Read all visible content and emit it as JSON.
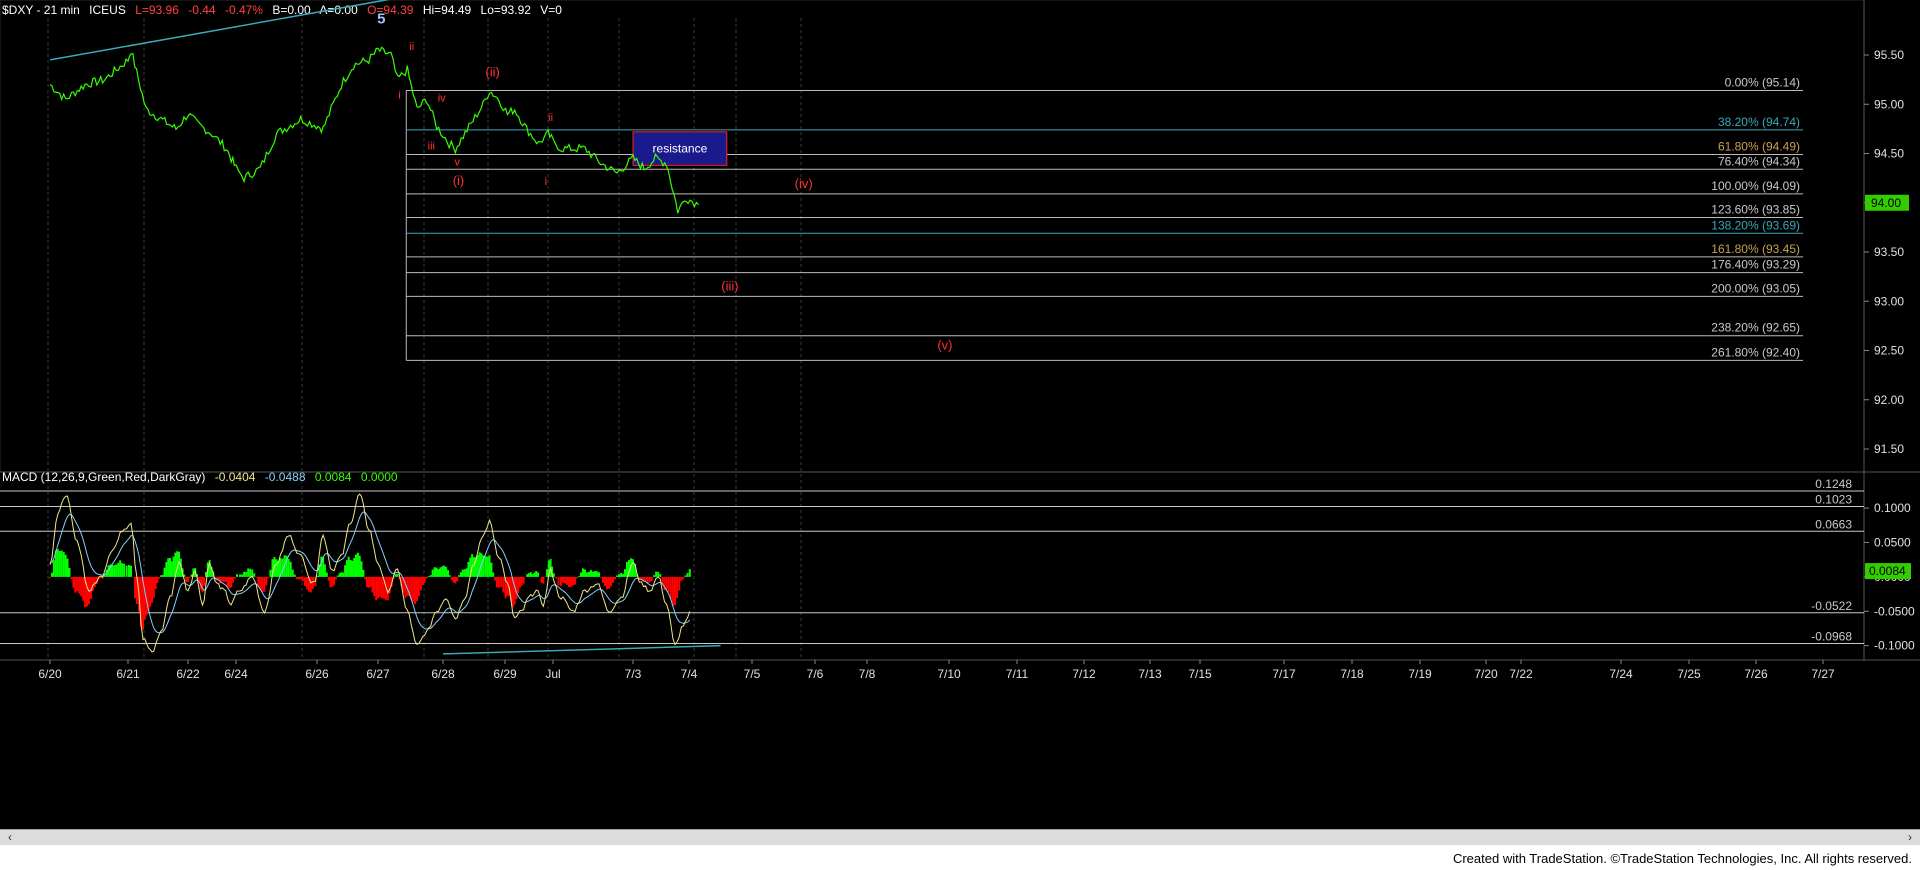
{
  "header": {
    "symbol": "$DXY - 21 min",
    "exchange": "ICEUS",
    "last": "L=93.96",
    "change": "-0.44",
    "change_pct": "-0.47%",
    "bid": "B=0.00",
    "ask": "A=0.00",
    "open": "O=94.39",
    "high": "Hi=94.49",
    "low": "Lo=93.92",
    "volume": "V=0"
  },
  "macd_header": {
    "label": "MACD (12,26,9,Green,Red,DarkGray)",
    "v1": "-0.0404",
    "v2": "-0.0488",
    "v3": "0.0084",
    "v4": "0.0000"
  },
  "footer": {
    "text": "Created with TradeStation. ©TradeStation Technologies, Inc. All rights reserved."
  },
  "colors": {
    "price": "#33ff00",
    "trendline": "#3aa8b8",
    "wave_label": "#ff3333",
    "wave5": "#9fc5ff",
    "fib_line": "#c8c8c8",
    "macd_line": "#f0e68c",
    "signal_line": "#87cefa",
    "hist_up": "#00ff00",
    "hist_down": "#ff0000",
    "resistance_fill": "#1a1a8c"
  },
  "chart_data": [
    {
      "type": "line",
      "title": "$DXY - 21 min",
      "y_range": [
        91.2,
        96.1
      ],
      "y_ticks": [
        "95.50",
        "95.00",
        "94.50",
        "94.00",
        "93.50",
        "93.00",
        "92.50",
        "92.00",
        "91.50"
      ],
      "x_labels": [
        "6/20",
        "6/21",
        "6/22",
        "6/24",
        "6/26",
        "6/27",
        "6/28",
        "6/29",
        "Jul",
        "7/3",
        "7/4",
        "7/5",
        "7/6",
        "7/8",
        "7/10",
        "7/11",
        "7/12",
        "7/13",
        "7/15",
        "7/17",
        "7/18",
        "7/19",
        "7/20",
        "7/22",
        "7/24",
        "7/25",
        "7/26",
        "7/27"
      ],
      "price_key_points": [
        [
          0,
          95.2
        ],
        [
          0.2,
          95.05
        ],
        [
          0.45,
          95.2
        ],
        [
          0.7,
          95.25
        ],
        [
          1.0,
          95.45
        ],
        [
          1.05,
          95.55
        ],
        [
          1.3,
          94.95
        ],
        [
          1.55,
          94.85
        ],
        [
          1.8,
          94.75
        ],
        [
          2.0,
          94.9
        ],
        [
          2.2,
          94.8
        ],
        [
          2.5,
          94.7
        ],
        [
          2.8,
          94.55
        ],
        [
          3.1,
          94.25
        ],
        [
          3.3,
          94.35
        ],
        [
          3.5,
          94.7
        ],
        [
          3.8,
          94.85
        ],
        [
          4.1,
          94.75
        ],
        [
          4.4,
          95.2
        ],
        [
          4.6,
          95.4
        ],
        [
          4.85,
          95.45
        ],
        [
          5.0,
          95.55
        ],
        [
          5.2,
          95.5
        ],
        [
          5.3,
          95.25
        ],
        [
          5.45,
          95.35
        ],
        [
          5.6,
          94.95
        ],
        [
          5.75,
          95.05
        ],
        [
          5.9,
          94.78
        ],
        [
          6.1,
          94.6
        ],
        [
          6.2,
          94.55
        ],
        [
          6.45,
          94.8
        ],
        [
          6.65,
          95.0
        ],
        [
          6.75,
          95.14
        ],
        [
          6.9,
          95.05
        ],
        [
          7.05,
          94.9
        ],
        [
          7.2,
          94.95
        ],
        [
          7.45,
          94.75
        ],
        [
          7.7,
          94.6
        ],
        [
          7.9,
          94.7
        ],
        [
          8.1,
          94.55
        ],
        [
          8.4,
          94.55
        ],
        [
          8.6,
          94.4
        ],
        [
          8.8,
          94.3
        ],
        [
          9.0,
          94.45
        ],
        [
          9.2,
          94.35
        ],
        [
          9.4,
          94.45
        ],
        [
          9.6,
          94.4
        ],
        [
          9.8,
          93.92
        ],
        [
          9.95,
          94.05
        ],
        [
          10.15,
          93.98
        ]
      ],
      "fib_levels": [
        {
          "label": "0.00% (95.14)",
          "value": 95.14
        },
        {
          "label": "38.20% (94.74)",
          "value": 94.74
        },
        {
          "label": "61.80% (94.49)",
          "value": 94.49
        },
        {
          "label": "76.40% (94.34)",
          "value": 94.34
        },
        {
          "label": "100.00% (94.09)",
          "value": 94.09
        },
        {
          "label": "123.60% (93.85)",
          "value": 93.85
        },
        {
          "label": "138.20% (93.69)",
          "value": 93.69
        },
        {
          "label": "161.80% (93.45)",
          "value": 93.45
        },
        {
          "label": "176.40% (93.29)",
          "value": 93.29
        },
        {
          "label": "200.00% (93.05)",
          "value": 93.05
        },
        {
          "label": "238.20% (92.65)",
          "value": 92.65
        },
        {
          "label": "261.80% (92.40)",
          "value": 92.4
        }
      ],
      "fib_anchor_x": 5.45,
      "fib_label_colors": [
        "#c8c8c8",
        "#3aa8b8",
        "#c8a050",
        "#c8c8c8",
        "#c8c8c8",
        "#c8c8c8",
        "#3aa8b8",
        "#c8a050",
        "#c8c8c8",
        "#c8c8c8",
        "#c8c8c8",
        "#c8c8c8"
      ],
      "resistance": {
        "label": "resistance",
        "x0": 9.0,
        "x1": 10.6,
        "y_top": 94.72,
        "y_bottom": 94.38
      },
      "trendline": {
        "x0": 0,
        "y0": 95.45,
        "x1": 6.0,
        "y1": 96.05
      },
      "current_price": "94.00",
      "current_price_value": 94.0,
      "wave_labels": [
        {
          "text": "5",
          "x": 5.05,
          "y": 95.82,
          "color": "#9fc5ff",
          "size": 15
        },
        {
          "text": "ii",
          "x": 5.52,
          "y": 95.55,
          "color": "#ff3333",
          "size": 11
        },
        {
          "text": "i",
          "x": 5.33,
          "y": 95.06,
          "color": "#ff3333",
          "size": 11
        },
        {
          "text": "iv",
          "x": 5.98,
          "y": 95.03,
          "color": "#ff3333",
          "size": 11
        },
        {
          "text": "iii",
          "x": 5.82,
          "y": 94.54,
          "color": "#ff3333",
          "size": 11
        },
        {
          "text": "v",
          "x": 6.23,
          "y": 94.38,
          "color": "#ff3333",
          "size": 11
        },
        {
          "text": "(i)",
          "x": 6.25,
          "y": 94.18,
          "color": "#ff3333",
          "size": 13
        },
        {
          "text": "(ii)",
          "x": 6.8,
          "y": 95.28,
          "color": "#ff3333",
          "size": 13
        },
        {
          "text": "ii",
          "x": 7.95,
          "y": 94.83,
          "color": "#ff3333",
          "size": 11
        },
        {
          "text": "i",
          "x": 7.85,
          "y": 94.18,
          "color": "#ff3333",
          "size": 11
        },
        {
          "text": "(iv)",
          "x": 11.82,
          "y": 94.15,
          "color": "#ff3333",
          "size": 13
        },
        {
          "text": "(iii)",
          "x": 10.65,
          "y": 93.11,
          "color": "#ff3333",
          "size": 13
        },
        {
          "text": "(v)",
          "x": 13.95,
          "y": 92.51,
          "color": "#ff3333",
          "size": 13
        }
      ]
    },
    {
      "type": "line",
      "title": "MACD (12,26,9,Green,Red,DarkGray)",
      "y_range": [
        -0.115,
        0.135
      ],
      "y_ticks": [
        "0.1000",
        "0.0500",
        "0.0000",
        "-0.0500",
        "-0.1000"
      ],
      "levels": [
        {
          "label": "0.1248",
          "value": 0.1248
        },
        {
          "label": "0.1023",
          "value": 0.1023
        },
        {
          "label": "0.0663",
          "value": 0.0663
        },
        {
          "label": "-0.0522",
          "value": -0.0522
        },
        {
          "label": "-0.0968",
          "value": -0.0968
        }
      ],
      "current_value": "0.0084",
      "current_value_num": 0.0084,
      "macd_key_points": [
        [
          0,
          0.02
        ],
        [
          0.1,
          0.09
        ],
        [
          0.2,
          0.12
        ],
        [
          0.35,
          0.05
        ],
        [
          0.5,
          -0.02
        ],
        [
          0.65,
          0.0
        ],
        [
          0.8,
          0.04
        ],
        [
          0.95,
          0.07
        ],
        [
          1.05,
          0.08
        ],
        [
          1.15,
          0.0
        ],
        [
          1.25,
          -0.09
        ],
        [
          1.4,
          -0.11
        ],
        [
          1.55,
          -0.08
        ],
        [
          1.7,
          -0.03
        ],
        [
          1.85,
          0.02
        ],
        [
          2.0,
          -0.02
        ],
        [
          2.15,
          0.01
        ],
        [
          2.3,
          -0.04
        ],
        [
          2.45,
          0.02
        ],
        [
          2.6,
          -0.01
        ],
        [
          2.75,
          -0.02
        ],
        [
          2.9,
          -0.04
        ],
        [
          3.05,
          -0.02
        ],
        [
          3.2,
          0.0
        ],
        [
          3.35,
          -0.05
        ],
        [
          3.5,
          0.02
        ],
        [
          3.65,
          0.06
        ],
        [
          3.8,
          0.03
        ],
        [
          3.95,
          -0.01
        ],
        [
          4.1,
          0.06
        ],
        [
          4.25,
          0.01
        ],
        [
          4.4,
          0.03
        ],
        [
          4.55,
          0.08
        ],
        [
          4.7,
          0.12
        ],
        [
          4.85,
          0.07
        ],
        [
          5.0,
          0.02
        ],
        [
          5.15,
          -0.02
        ],
        [
          5.3,
          0.01
        ],
        [
          5.45,
          -0.05
        ],
        [
          5.6,
          -0.1
        ],
        [
          5.75,
          -0.08
        ],
        [
          5.9,
          -0.05
        ],
        [
          6.05,
          -0.03
        ],
        [
          6.2,
          -0.06
        ],
        [
          6.35,
          -0.03
        ],
        [
          6.5,
          0.02
        ],
        [
          6.65,
          0.06
        ],
        [
          6.75,
          0.08
        ],
        [
          6.9,
          0.03
        ],
        [
          7.05,
          -0.01
        ],
        [
          7.2,
          -0.06
        ],
        [
          7.35,
          -0.05
        ],
        [
          7.5,
          -0.03
        ],
        [
          7.65,
          -0.02
        ],
        [
          7.8,
          -0.04
        ],
        [
          7.95,
          0.01
        ],
        [
          8.1,
          -0.03
        ],
        [
          8.25,
          -0.05
        ],
        [
          8.4,
          -0.02
        ],
        [
          8.55,
          -0.01
        ],
        [
          8.7,
          -0.05
        ],
        [
          8.85,
          -0.03
        ],
        [
          9.0,
          0.02
        ],
        [
          9.15,
          -0.01
        ],
        [
          9.3,
          -0.02
        ],
        [
          9.45,
          0.0
        ],
        [
          9.6,
          -0.04
        ],
        [
          9.75,
          -0.1
        ],
        [
          9.9,
          -0.07
        ],
        [
          10.05,
          -0.05
        ]
      ]
    }
  ]
}
